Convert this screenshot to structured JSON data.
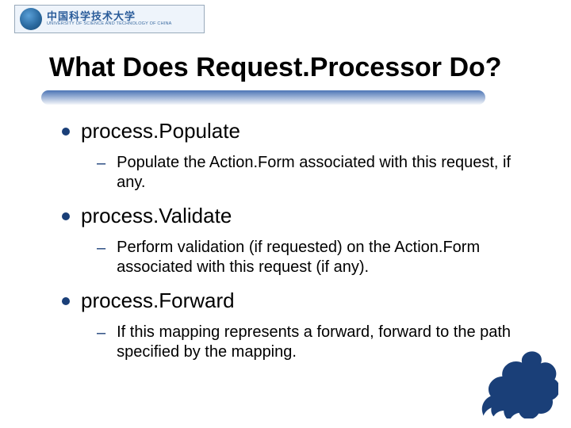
{
  "logo": {
    "cn": "中国科学技术大学",
    "en": "UNIVERSITY OF SCIENCE AND TECHNOLOGY OF CHINA"
  },
  "title": "What Does Request.Processor Do?",
  "items": [
    {
      "label": "process.Populate",
      "sub": "Populate the Action.Form associated with this request, if any."
    },
    {
      "label": "process.Validate",
      "sub": "Perform validation (if requested) on the Action.Form associated with this request (if any)."
    },
    {
      "label": "process.Forward",
      "sub": "If this mapping represents a forward, forward to the path specified by the mapping."
    }
  ]
}
